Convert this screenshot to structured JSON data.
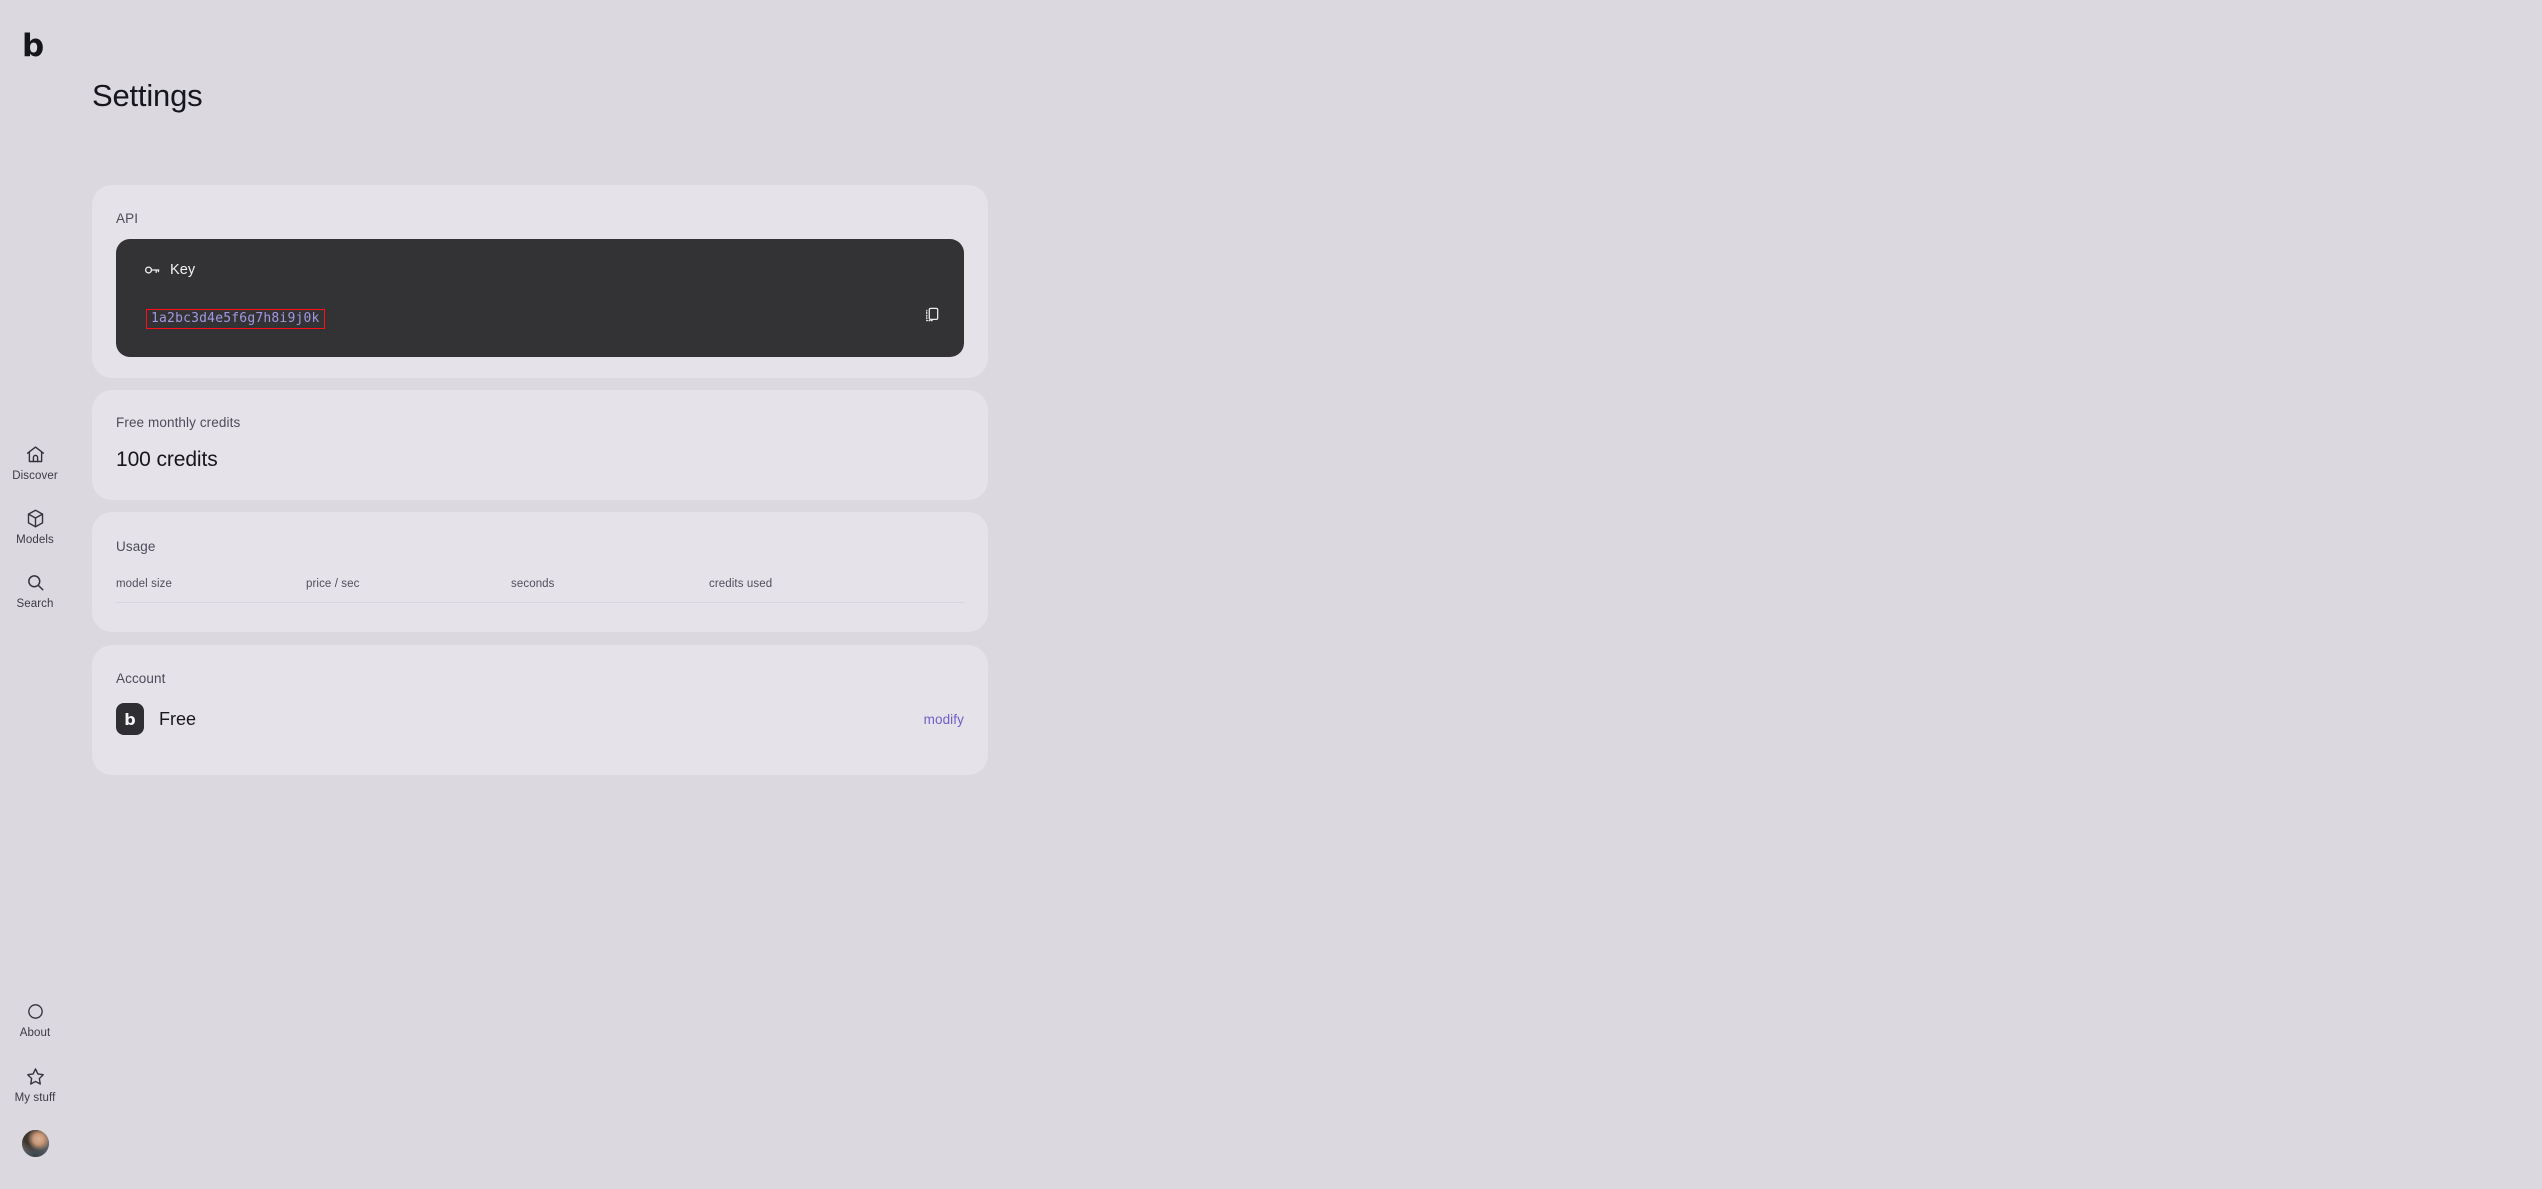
{
  "brand": {
    "logo_text": "b"
  },
  "page": {
    "title": "Settings"
  },
  "sidebar": {
    "main_items": [
      {
        "label": "Discover",
        "icon": "home-icon"
      },
      {
        "label": "Models",
        "icon": "cube-icon"
      },
      {
        "label": "Search",
        "icon": "search-icon"
      }
    ],
    "bottom_items": [
      {
        "label": "About",
        "icon": "circle-icon"
      },
      {
        "label": "My stuff",
        "icon": "star-icon"
      }
    ],
    "avatar": {
      "name": "user-avatar"
    }
  },
  "api": {
    "section_label": "API",
    "key_panel": {
      "title": "Key",
      "icon": "key-icon",
      "value": "1a2bc3d4e5f6g7h8i9j0k",
      "copy_icon": "copy-icon",
      "highlight_border_color": "#ff0f17",
      "value_color": "#a198e0",
      "panel_color": "#333336"
    }
  },
  "credits": {
    "section_label": "Free monthly credits",
    "value": "100 credits"
  },
  "usage": {
    "section_label": "Usage",
    "columns": [
      "model size",
      "price / sec",
      "seconds",
      "credits used"
    ],
    "rows": []
  },
  "account": {
    "section_label": "Account",
    "badge_text": "b",
    "plan": "Free",
    "modify_label": "modify",
    "modify_color": "#6f5fc8"
  },
  "theme": {
    "page_bg": "#dcd8e0",
    "card_bg": "#e6e2e9",
    "text": "#16161d"
  }
}
